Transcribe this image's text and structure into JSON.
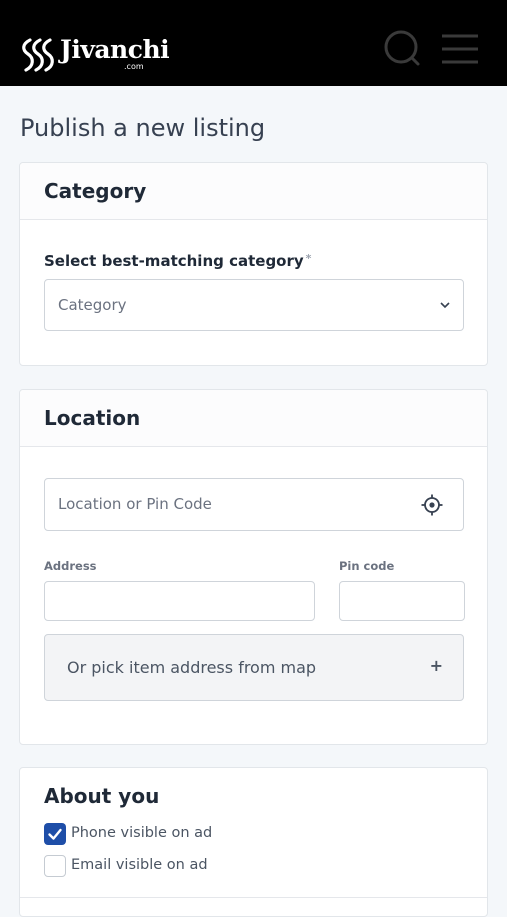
{
  "header": {
    "logo_text": "Jivanchi",
    "logo_sub": ".com",
    "search_icon": "search-icon",
    "menu_icon": "hamburger-menu-icon",
    "background": "#000000"
  },
  "page": {
    "title": "Publish a new listing"
  },
  "category_section": {
    "title": "Category",
    "field_label": "Select best-matching category",
    "required_mark": "*",
    "select_value": "Category"
  },
  "location_section": {
    "title": "Location",
    "location_placeholder": "Location or Pin Code",
    "locate_icon": "crosshair-icon",
    "address_label": "Address",
    "address_value": "",
    "pincode_label": "Pin code",
    "pincode_value": "",
    "map_button_label": "Or pick item address from map",
    "map_button_icon": "+"
  },
  "about_section": {
    "title": "About you",
    "options": [
      {
        "label": "Phone visible on ad",
        "checked": true
      },
      {
        "label": "Email visible on ad",
        "checked": false
      }
    ]
  },
  "colors": {
    "accent": "#1e4ea8",
    "page_bg": "#f4f7fa"
  }
}
